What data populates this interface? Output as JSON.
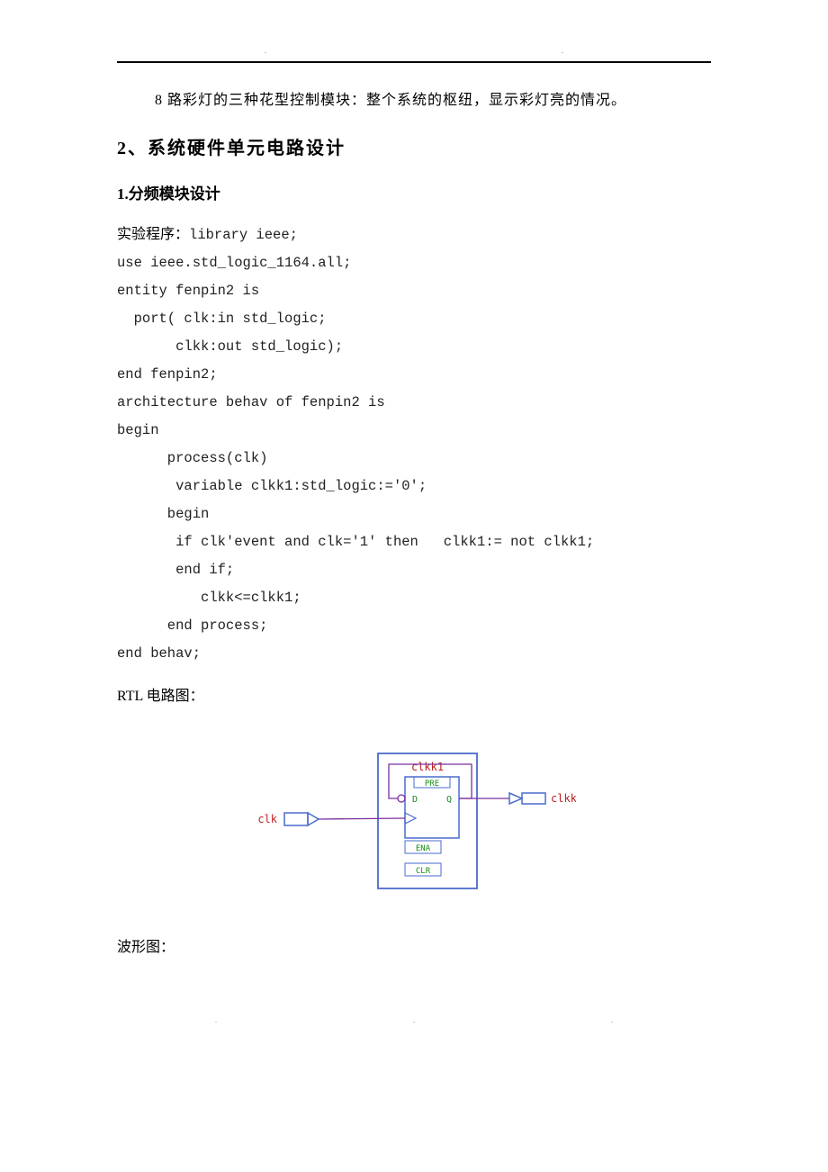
{
  "intro_text": "8 路彩灯的三种花型控制模块：整个系统的枢纽，显示彩灯亮的情况。",
  "section_heading": "2、系统硬件单元电路设计",
  "sub_heading": "1.分频模块设计",
  "code_label_prefix": "实验程序：",
  "code_lines": [
    "library ieee;",
    "use ieee.std_logic_1164.all;",
    "entity fenpin2 is",
    "  port( clk:in std_logic;",
    "       clkk:out std_logic);",
    "end fenpin2;",
    "architecture behav of fenpin2 is",
    "begin",
    "      process(clk)",
    "       variable clkk1:std_logic:='0';",
    "      begin",
    "       if clk'event and clk='1' then   clkk1:= not clkk1;",
    "       end if;",
    "          clkk<=clkk1;",
    "      end process;",
    "end behav;"
  ],
  "rtl_label": "RTL 电路图：",
  "waveform_label": "波形图：",
  "diagram": {
    "block_label": "clkk1",
    "input_label": "clk",
    "output_label": "clkk",
    "pre_label": "PRE",
    "d_label": "D",
    "q_label": "Q",
    "ena_label": "ENA",
    "clr_label": "CLR"
  }
}
